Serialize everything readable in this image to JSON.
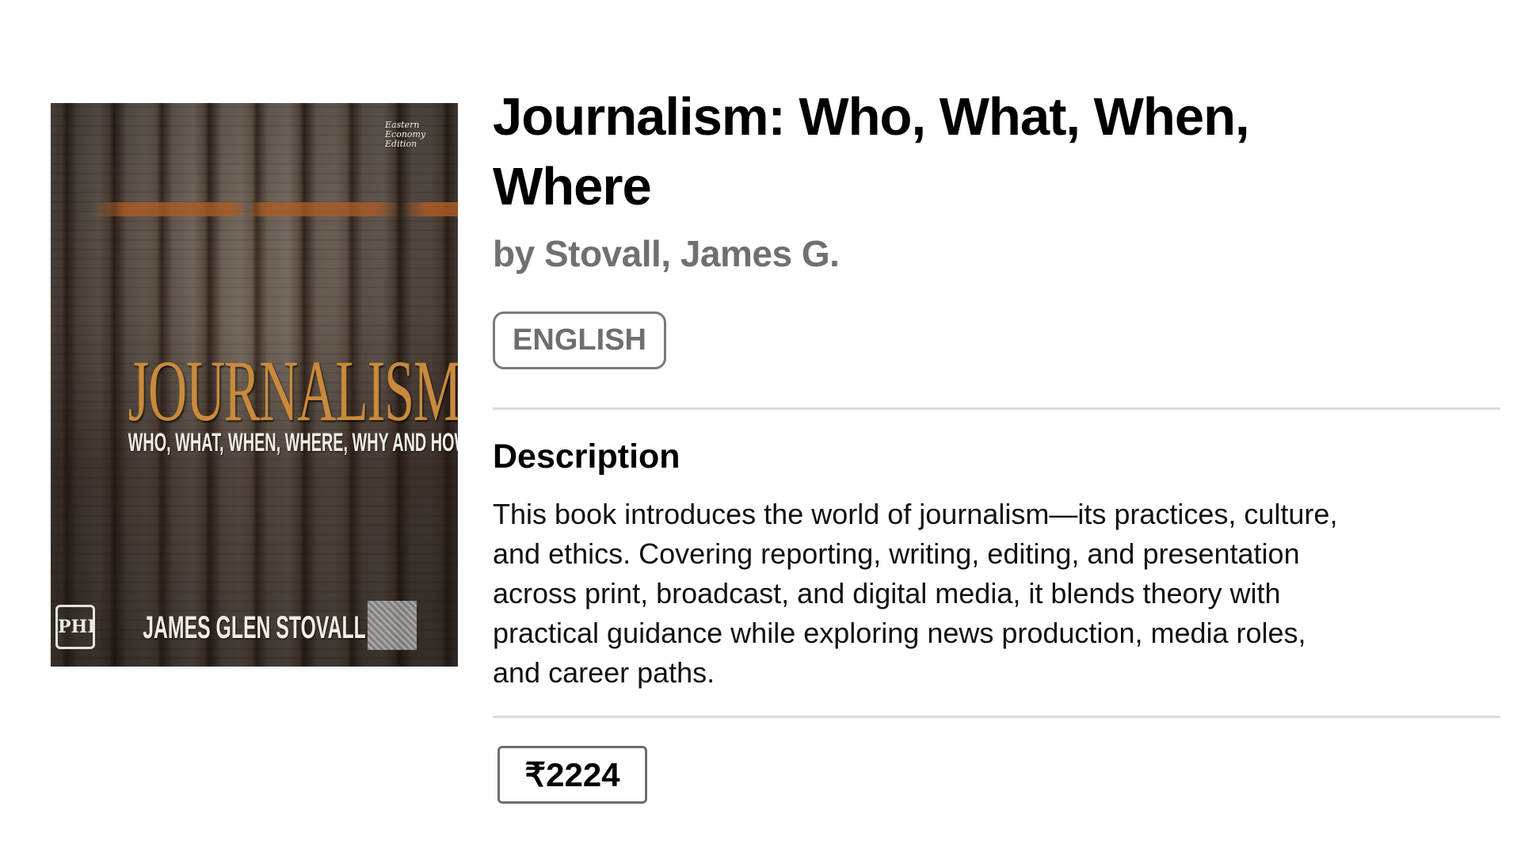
{
  "book": {
    "cover": {
      "edition_text": "Eastern Economy Edition",
      "title": "JOURNALISM",
      "subtitle": "WHO, WHAT, WHEN, WHERE, WHY AND HOW",
      "author": "JAMES GLEN STOVALL",
      "publisher_logo": "PHI"
    },
    "title": "Journalism: Who, What, When, Where",
    "author": "by Stovall, James G.",
    "language": "ENGLISH",
    "description_heading": "Description",
    "description": "This book introduces the world of journalism—its practices, culture, and ethics. Covering reporting, writing, editing, and presentation across print, broadcast, and digital media, it blends theory with practical guidance while exploring news production, media roles, and career paths.",
    "price": "₹2224"
  }
}
